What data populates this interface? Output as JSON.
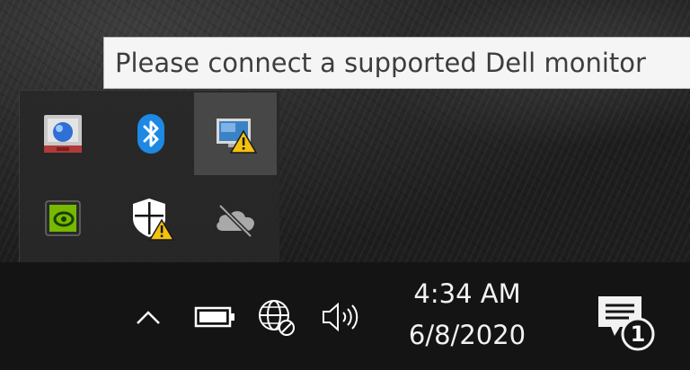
{
  "tooltip": {
    "text": "Please connect a supported Dell monitor"
  },
  "tray_overflow": {
    "icons": [
      {
        "name": "network-globe-app-icon"
      },
      {
        "name": "bluetooth-icon",
        "color": "#1e88e5"
      },
      {
        "name": "dell-display-warning-icon",
        "selected": true
      },
      {
        "name": "nvidia-icon",
        "color": "#76b900"
      },
      {
        "name": "windows-security-warning-icon"
      },
      {
        "name": "onedrive-offline-icon"
      }
    ]
  },
  "taskbar": {
    "clock": {
      "time": "4:34 AM",
      "date": "6/8/2020"
    },
    "notifications": {
      "count": "1"
    }
  },
  "colors": {
    "warning": "#f4c20d",
    "taskbar": "#141414",
    "panel": "#282828"
  }
}
